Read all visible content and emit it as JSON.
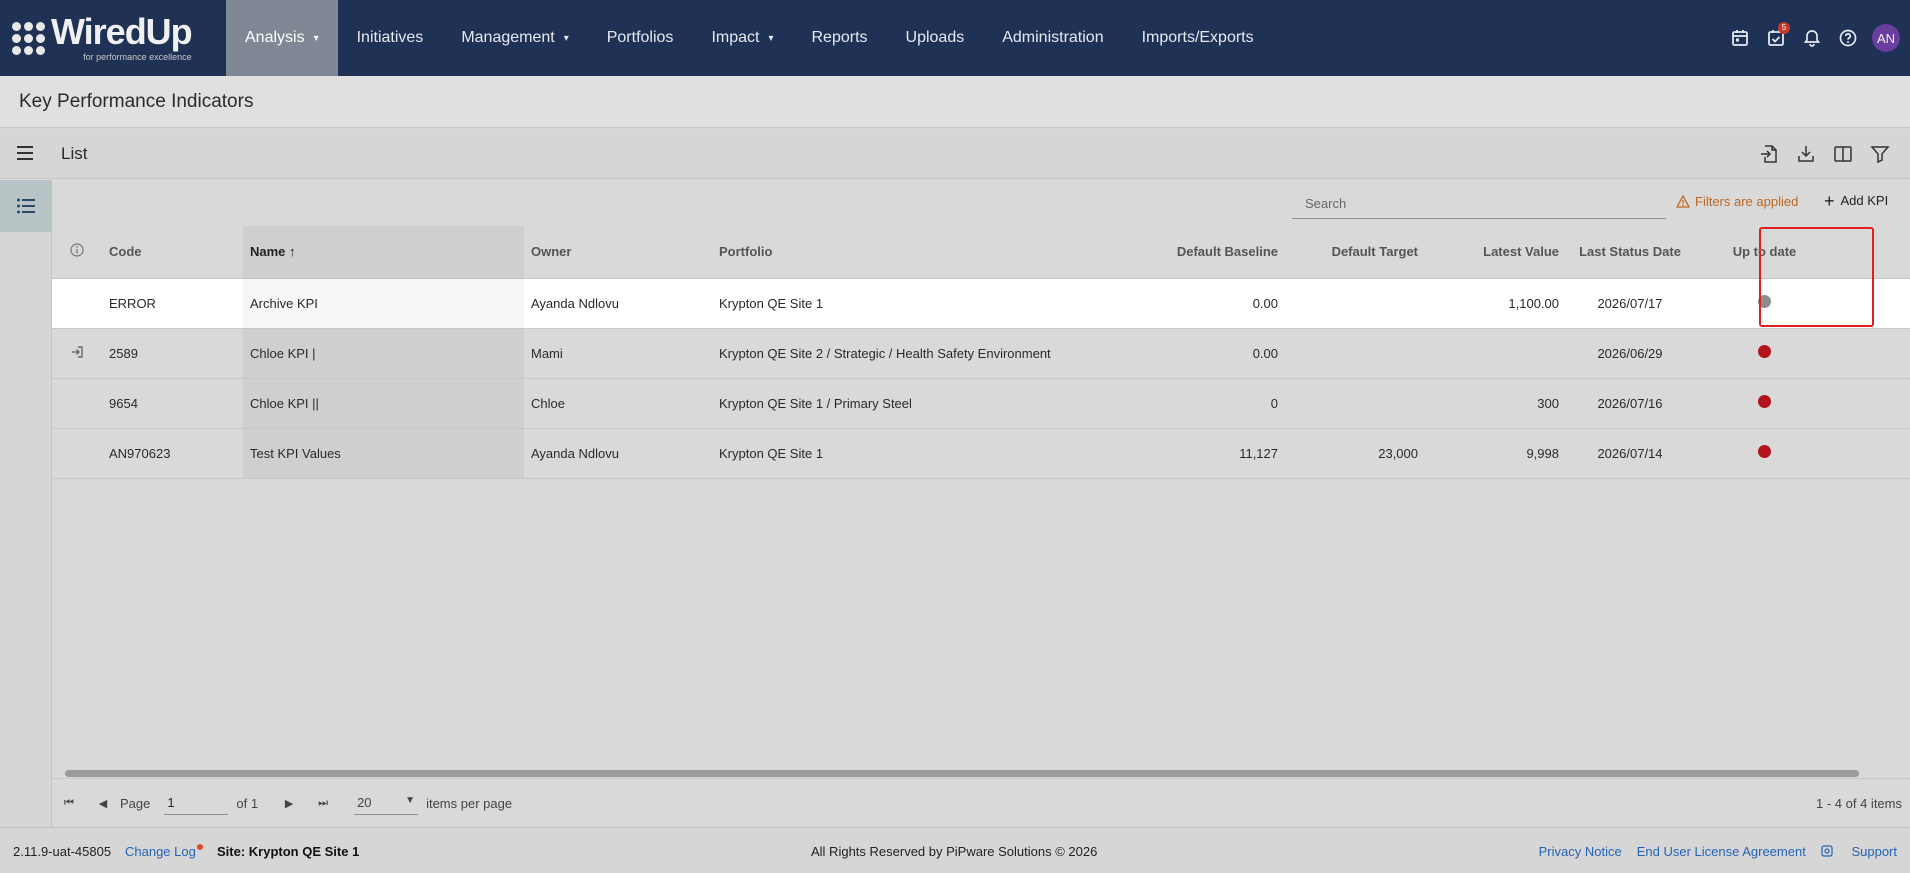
{
  "brand": {
    "name": "WiredUp",
    "tagline": "for performance excellence"
  },
  "nav": {
    "items": [
      {
        "label": "Analysis",
        "has_caret": true,
        "active": true
      },
      {
        "label": "Initiatives",
        "has_caret": false
      },
      {
        "label": "Management",
        "has_caret": true
      },
      {
        "label": "Portfolios",
        "has_caret": false
      },
      {
        "label": "Impact",
        "has_caret": true
      },
      {
        "label": "Reports",
        "has_caret": false
      },
      {
        "label": "Uploads",
        "has_caret": false
      },
      {
        "label": "Administration",
        "has_caret": false
      },
      {
        "label": "Imports/Exports",
        "has_caret": false
      }
    ],
    "caret": "▾",
    "tasks_badge": "5",
    "avatar_initials": "AN"
  },
  "page": {
    "title": "Key Performance Indicators"
  },
  "listbar": {
    "title": "List"
  },
  "toolbar": {
    "search_placeholder": "Search",
    "filters_label": "Filters are applied",
    "add_label": "Add KPI",
    "add_icon": "+"
  },
  "table": {
    "headers": {
      "code": "Code",
      "name": "Name",
      "sort_arrow": "↑",
      "owner": "Owner",
      "portfolio": "Portfolio",
      "baseline": "Default Baseline",
      "target": "Default Target",
      "latest": "Latest Value",
      "status_date": "Last Status Date",
      "uptodate": "Up to date"
    },
    "rows": [
      {
        "code": "ERROR",
        "name": "Archive KPI",
        "owner": "Ayanda Ndlovu",
        "portfolio": "Krypton QE Site 1",
        "baseline": "0.00",
        "target": "",
        "latest": "1,100.00",
        "status_date": "2026/07/17",
        "status_color": "#8c8c8c",
        "highlighted": true,
        "icon": ""
      },
      {
        "code": "2589",
        "name": "Chloe KPI |",
        "owner": "Mami",
        "portfolio": "Krypton QE Site 2 / Strategic / Health Safety Environment",
        "baseline": "0.00",
        "target": "",
        "latest": "",
        "status_date": "2026/06/29",
        "status_color": "#b3141c",
        "highlighted": false,
        "icon": "login-icon"
      },
      {
        "code": "9654",
        "name": "Chloe KPI ||",
        "owner": "Chloe",
        "portfolio": "Krypton QE Site 1 / Primary Steel",
        "baseline": "0",
        "target": "",
        "latest": "300",
        "status_date": "2026/07/16",
        "status_color": "#b3141c",
        "highlighted": false,
        "icon": ""
      },
      {
        "code": "AN970623",
        "name": "Test KPI Values",
        "owner": "Ayanda Ndlovu",
        "portfolio": "Krypton QE Site 1",
        "baseline": "11,127",
        "target": "23,000",
        "latest": "9,998",
        "status_date": "2026/07/14",
        "status_color": "#b3141c",
        "highlighted": false,
        "icon": ""
      }
    ]
  },
  "pager": {
    "page_label": "Page",
    "page_value": "1",
    "of_label": "of 1",
    "per_page_value": "20",
    "per_page_label": "items per page",
    "range": "1 - 4 of 4 items",
    "first": "⏮",
    "prev": "◀",
    "next": "▶",
    "last": "⏭",
    "dropdown_caret": "▼"
  },
  "footer": {
    "version": "2.11.9-uat-45805",
    "change_log": "Change Log",
    "site": "Site: Krypton QE Site 1",
    "copyright": "All Rights Reserved by PiPware Solutions © 2026",
    "privacy": "Privacy Notice",
    "eula": "End User License Agreement",
    "support": "Support"
  },
  "colors": {
    "nav_bg": "#1f3155",
    "nav_active_bg": "#7f8894",
    "filters_warning": "#c0661e",
    "link": "#2563b4",
    "status_red": "#b3141c",
    "status_grey": "#8c8c8c",
    "highlight_box": "#e02020"
  }
}
